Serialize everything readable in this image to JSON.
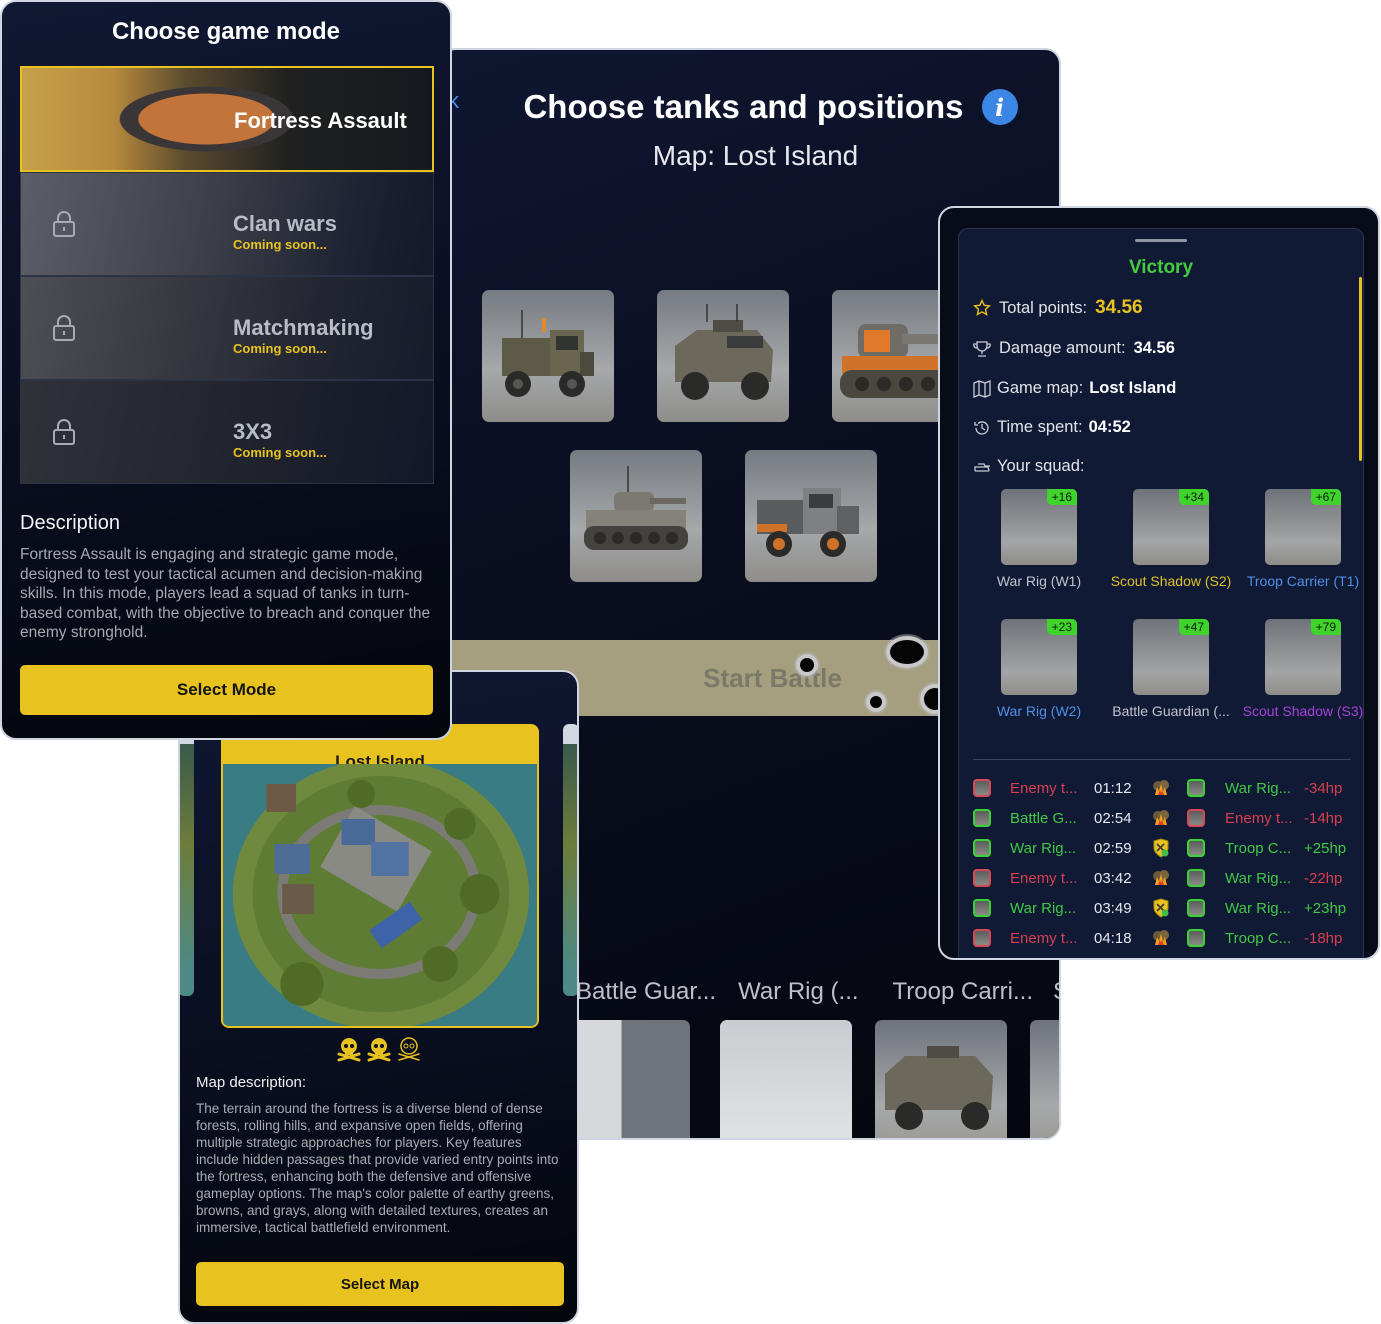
{
  "tanks_screen": {
    "back_label": "Back",
    "title": "Choose tanks and positions",
    "map_label": "Map: Lost Island",
    "info_icon": "info-icon",
    "tank_options": [
      "War Rig",
      "Troop Carrier",
      "Scout Shadow",
      "Battle Guardian",
      "War Rig"
    ],
    "start_battle_label": "Start Battle",
    "bottom_names": [
      "Battle Guar...",
      "War Rig (...",
      "Troop Carri...",
      "Sco"
    ]
  },
  "mode_screen": {
    "title": "Choose game mode",
    "modes": [
      {
        "name": "Fortress Assault",
        "status": "",
        "locked": false,
        "selected": true
      },
      {
        "name": "Clan wars",
        "status": "Coming soon...",
        "locked": true,
        "selected": false
      },
      {
        "name": "Matchmaking",
        "status": "Coming soon...",
        "locked": true,
        "selected": false
      },
      {
        "name": "3X3",
        "status": "Coming soon...",
        "locked": true,
        "selected": false
      }
    ],
    "description_title": "Description",
    "description": "Fortress Assault is engaging and strategic game mode, designed to test your tactical acumen and decision-making skills. In this mode, players lead a squad of tanks in turn-based combat, with the objective to breach and conquer the enemy stronghold.",
    "select_button": "Select Mode"
  },
  "map_screen": {
    "map_name": "Lost Island",
    "difficulty": {
      "filled": 2,
      "total": 3
    },
    "description_title": "Map description:",
    "description": "The terrain around the fortress is a diverse blend of dense forests, rolling hills, and expansive open fields, offering multiple strategic approaches for players. Key features include hidden passages that provide varied entry points into the fortress, enhancing both the defensive and offensive gameplay options. The map's color palette of earthy greens, browns, and grays, along with detailed textures, creates an immersive, tactical battlefield environment.",
    "select_button": "Select Map"
  },
  "victory_screen": {
    "title": "Victory",
    "stats": {
      "total_points_label": "Total points:",
      "total_points": "34.56",
      "damage_label": "Damage amount:",
      "damage": "34.56",
      "map_label": "Game map:",
      "map": "Lost Island",
      "time_label": "Time spent:",
      "time": "04:52",
      "squad_label": "Your squad:"
    },
    "squad": [
      {
        "name": "War Rig (W1)",
        "bonus": "+16",
        "color": "#c0c4cc"
      },
      {
        "name": "Scout Shadow (S2)",
        "bonus": "+34",
        "color": "#e0c12a"
      },
      {
        "name": "Troop Carrier (T1)",
        "bonus": "+67",
        "color": "#4f8fe6"
      },
      {
        "name": "War Rig (W2)",
        "bonus": "+23",
        "color": "#4f8fe6"
      },
      {
        "name": "Battle Guardian (...",
        "bonus": "+47",
        "color": "#c0c4cc"
      },
      {
        "name": "Scout Shadow (S3)",
        "bonus": "+79",
        "color": "#a743d8"
      }
    ],
    "log": [
      {
        "attacker": "Enemy t...",
        "attacker_side": "enemy",
        "time": "01:12",
        "action": "explosion",
        "target": "War Rig...",
        "target_side": "ally",
        "delta": "-34hp"
      },
      {
        "attacker": "Battle G...",
        "attacker_side": "ally",
        "time": "02:54",
        "action": "explosion",
        "target": "Enemy t...",
        "target_side": "enemy",
        "delta": "-14hp"
      },
      {
        "attacker": "War Rig...",
        "attacker_side": "ally",
        "time": "02:59",
        "action": "repair",
        "target": "Troop C...",
        "target_side": "ally",
        "delta": "+25hp"
      },
      {
        "attacker": "Enemy t...",
        "attacker_side": "enemy",
        "time": "03:42",
        "action": "explosion",
        "target": "War Rig...",
        "target_side": "ally",
        "delta": "-22hp"
      },
      {
        "attacker": "War Rig...",
        "attacker_side": "ally",
        "time": "03:49",
        "action": "repair",
        "target": "War Rig...",
        "target_side": "ally",
        "delta": "+23hp"
      },
      {
        "attacker": "Enemy t...",
        "attacker_side": "enemy",
        "time": "04:18",
        "action": "explosion",
        "target": "Troop C...",
        "target_side": "ally",
        "delta": "-18hp"
      }
    ]
  },
  "colors": {
    "accent_yellow": "#e8c21e",
    "victory_green": "#45cc3e",
    "enemy_red": "#d73e50",
    "info_blue": "#3c86e6"
  }
}
